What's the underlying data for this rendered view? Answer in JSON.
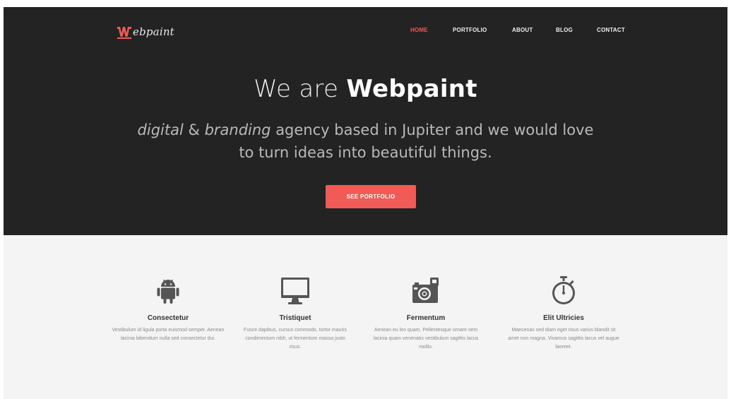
{
  "brand": {
    "logo_text": "ebpaint",
    "accent_color": "#f05a57"
  },
  "nav": {
    "items": [
      {
        "label": "HOME",
        "active": true
      },
      {
        "label": "PORTFOLIO",
        "active": false
      },
      {
        "label": "ABOUT",
        "active": false
      },
      {
        "label": "BLOG",
        "active": false
      },
      {
        "label": "CONTACT",
        "active": false
      }
    ]
  },
  "hero": {
    "title_prefix": "We are",
    "title_brand": "Webpaint",
    "subtitle_em1": "digital",
    "subtitle_amp": " & ",
    "subtitle_em2": "branding",
    "subtitle_rest1": " agency based in Jupiter and we would love",
    "subtitle_rest2": "to turn ideas into beautiful things.",
    "cta_label": "SEE PORTFOLIO",
    "background_color": "#232323"
  },
  "features": [
    {
      "icon": "android-icon",
      "title": "Consectetur",
      "text": "Vestibulum id ligula porta euismod semper. Aenean lacinia bibendum nulla sed consectetur dui."
    },
    {
      "icon": "monitor-icon",
      "title": "Tristiquet",
      "text": "Fusce dapibus, cursus commodo, tortor mauris condimentum nibh, ut fermentum massa justo risus."
    },
    {
      "icon": "camera-icon",
      "title": "Fermentum",
      "text": "Aenean eu leo quam. Pellentesque ornare sem lacinia quam venenatis vestibulum sagittis lacus mollis."
    },
    {
      "icon": "stopwatch-icon",
      "title": "Elit Ultricies",
      "text": "Maecenas sed diam eget risus varius blandit sit amet non magna. Vivamus sagittis lacus vel augue laoreet."
    }
  ]
}
